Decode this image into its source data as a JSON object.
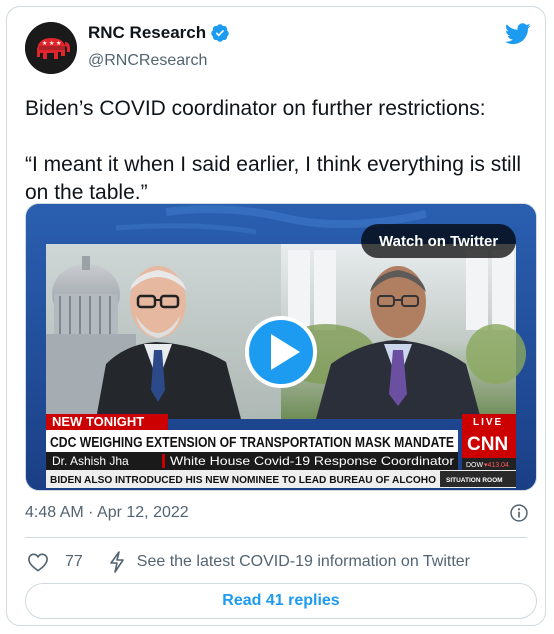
{
  "author": {
    "name": "RNC Research",
    "handle": "@RNCResearch",
    "verified": true
  },
  "tweet": {
    "line1": "Biden’s COVID coordinator on further restrictions:",
    "line2": "“I meant it when I said earlier, I think everything is still on the table.”"
  },
  "video": {
    "watch_label": "Watch on Twitter",
    "chyron_top": "NEW TONIGHT",
    "headline": "CDC WEIGHING EXTENSION OF TRANSPORTATION MASK MANDATE",
    "guest_name": "Dr. Ashish Jha",
    "guest_title": "White House Covid-19 Response Coordinator",
    "ticker": "BIDEN ALSO INTRODUCED HIS NEW NOMINEE TO LEAD BUREAU OF ALCOHO",
    "live_label": "LIVE",
    "network_logo": "CNN",
    "dow_label": "DOW",
    "dow_value": "▾413.04",
    "show_bug": "SITUATION ROOM"
  },
  "meta": {
    "timestamp": "4:48 AM · Apr 12, 2022"
  },
  "actions": {
    "like_count": "77",
    "covid_info": "See the latest COVID-19 information on Twitter"
  },
  "read_replies": "Read 41 replies",
  "colors": {
    "twitter_blue": "#1d9bf0",
    "text_secondary": "#536471",
    "border": "#cfd9de",
    "cnn_red": "#cc0000"
  }
}
